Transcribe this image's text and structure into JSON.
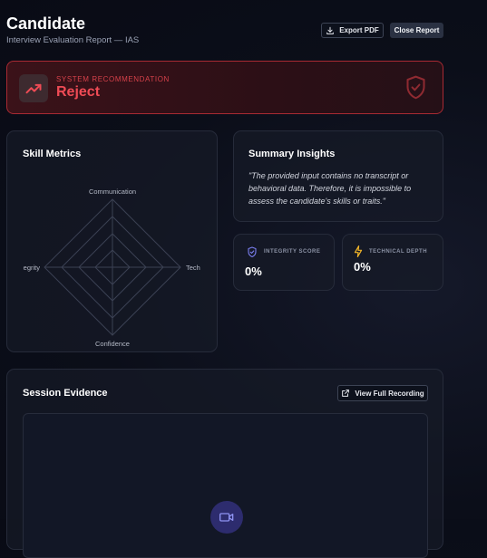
{
  "header": {
    "title": "Candidate",
    "subtitle": "Interview Evaluation Report — IAS",
    "export_label": "Export PDF",
    "close_label": "Close Report"
  },
  "recommendation": {
    "label": "SYSTEM RECOMMENDATION",
    "value": "Reject",
    "trend_icon": "trending-up-icon",
    "badge_icon": "shield-check-icon",
    "accent_color": "#ef4b55"
  },
  "skill_metrics": {
    "title": "Skill Metrics",
    "axes": [
      "Communication",
      "Tech",
      "Confidence",
      "egrity"
    ]
  },
  "summary": {
    "title": "Summary Insights",
    "text": "\"The provided input contains no transcript or behavioral data. Therefore, it is impossible to assess the candidate's skills or traits.\""
  },
  "metrics": [
    {
      "label": "INTEGRITY SCORE",
      "value": "0%",
      "icon": "shield-check-icon",
      "color": "#7b7ff0"
    },
    {
      "label": "TECHNICAL DEPTH",
      "value": "0%",
      "icon": "lightning-icon",
      "color": "#f0b429"
    }
  ],
  "session": {
    "title": "Session Evidence",
    "recording_label": "View Full Recording",
    "recording_icon": "external-link-icon",
    "video_icon": "video-camera-icon"
  }
}
